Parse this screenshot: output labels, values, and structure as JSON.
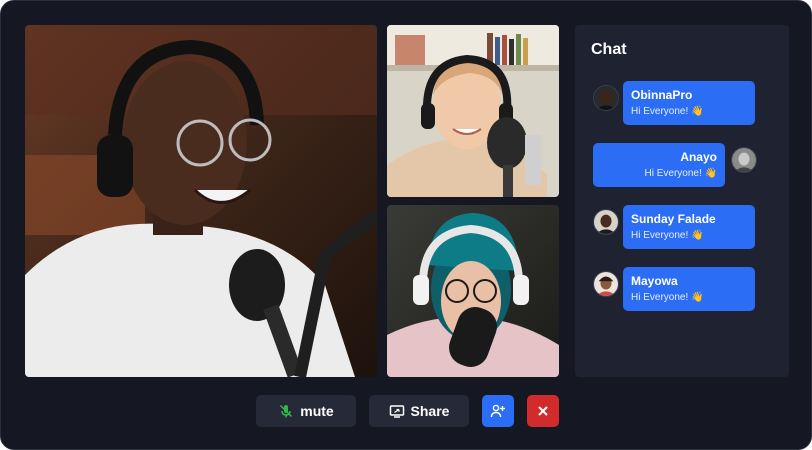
{
  "chat": {
    "title": "Chat",
    "messages": [
      {
        "name": "ObinnaPro",
        "text": "Hi Everyone!",
        "emoji": "👋",
        "side": "left"
      },
      {
        "name": "Anayo",
        "text": "Hi Everyone!",
        "emoji": "👋",
        "side": "right"
      },
      {
        "name": "Sunday Falade",
        "text": "Hi Everyone!",
        "emoji": "👋",
        "side": "left"
      },
      {
        "name": "Mayowa",
        "text": "Hi Everyone!",
        "emoji": "👋",
        "side": "left"
      }
    ]
  },
  "controls": {
    "mute_label": "mute",
    "share_label": "Share",
    "mute_icon": "microphone-off-icon",
    "share_icon": "screen-share-icon",
    "add_icon": "add-person-icon",
    "end_icon": "close-icon"
  },
  "colors": {
    "background": "#151722",
    "panel": "#1f2230",
    "accent": "#2b6ef5",
    "danger": "#d22b2b",
    "button": "#262938",
    "mute_icon": "#2fb84a"
  }
}
